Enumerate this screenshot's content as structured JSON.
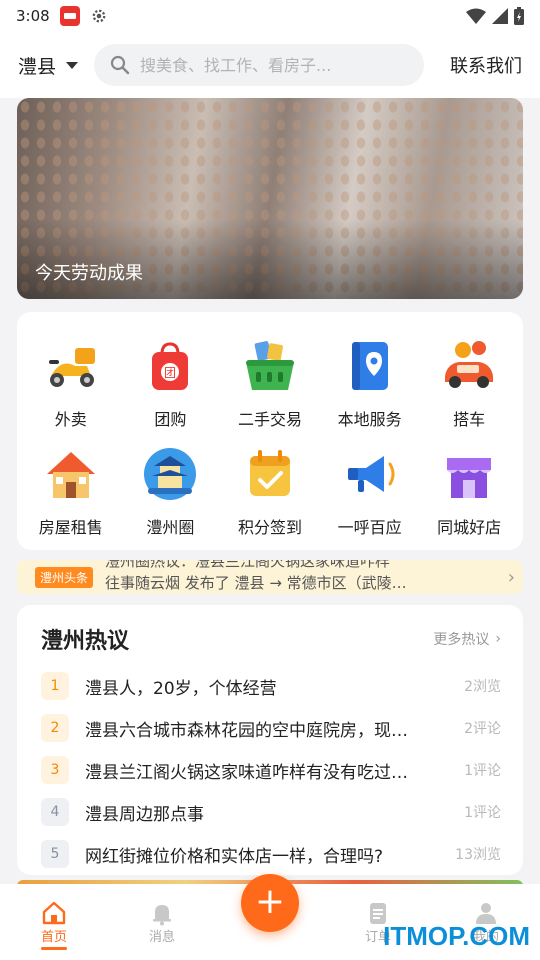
{
  "status_bar": {
    "time": "3:08"
  },
  "header": {
    "city": "澧县",
    "search_placeholder": "搜美食、找工作、看房子...",
    "contact": "联系我们"
  },
  "banner": {
    "caption": "今天劳动成果"
  },
  "services": [
    {
      "label": "外卖",
      "icon": "scooter-icon"
    },
    {
      "label": "团购",
      "icon": "shopping-bag-icon"
    },
    {
      "label": "二手交易",
      "icon": "basket-icon"
    },
    {
      "label": "本地服务",
      "icon": "map-pin-book-icon"
    },
    {
      "label": "搭车",
      "icon": "car-icon"
    },
    {
      "label": "房屋租售",
      "icon": "house-icon"
    },
    {
      "label": "澧州圈",
      "icon": "pagoda-icon"
    },
    {
      "label": "积分签到",
      "icon": "calendar-check-icon"
    },
    {
      "label": "一呼百应",
      "icon": "megaphone-icon"
    },
    {
      "label": "同城好店",
      "icon": "storefront-icon"
    }
  ],
  "ticker": {
    "tag": "澧州头条",
    "line1": "澧州圈热议：澧县兰江阁火锅这家味道咋样",
    "line2": "往事随云烟 发布了 澧县 → 常德市区（武陵…"
  },
  "hot": {
    "title": "澧州热议",
    "more": "更多热议",
    "items": [
      {
        "rank": "1",
        "text": "澧县人，20岁，个体经营",
        "meta": "2浏览"
      },
      {
        "rank": "2",
        "text": "澧县六合城市森林花园的空中庭院房，现…",
        "meta": "2评论"
      },
      {
        "rank": "3",
        "text": "澧县兰江阁火锅这家味道咋样有没有吃过…",
        "meta": "1评论"
      },
      {
        "rank": "4",
        "text": "澧县周边那点事",
        "meta": "1评论"
      },
      {
        "rank": "5",
        "text": "网红街摊位价格和实体店一样，合理吗?",
        "meta": "13浏览"
      }
    ]
  },
  "tabbar": {
    "home": "首页",
    "messages": "消息",
    "orders": "订单",
    "mine": "我的"
  },
  "watermark": "ITMOP.COM",
  "colors": {
    "accent": "#ff6a1a",
    "rank_top": "#f08a00",
    "ticker_bg": "#fdf4d7"
  }
}
